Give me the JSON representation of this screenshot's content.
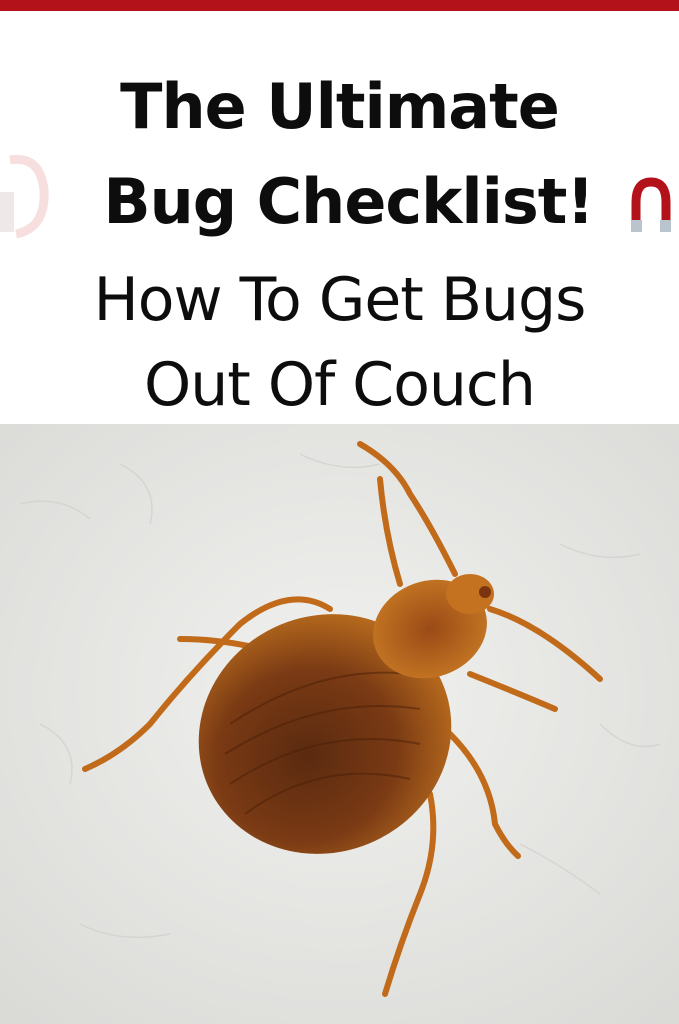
{
  "title": {
    "line1": "The Ultimate",
    "line2": "Bug Checklist!"
  },
  "subtitle": {
    "line1": "How To Get Bugs",
    "line2": "Out Of Couch"
  },
  "colors": {
    "accent_bar": "#b3121a",
    "text": "#0d0d0d",
    "background": "#ffffff",
    "bug_body": "#b8651a",
    "surface": "#e9e9e7"
  },
  "icons": {
    "left_decoration": "magnet-icon",
    "right_decoration": "magnet-icon"
  }
}
